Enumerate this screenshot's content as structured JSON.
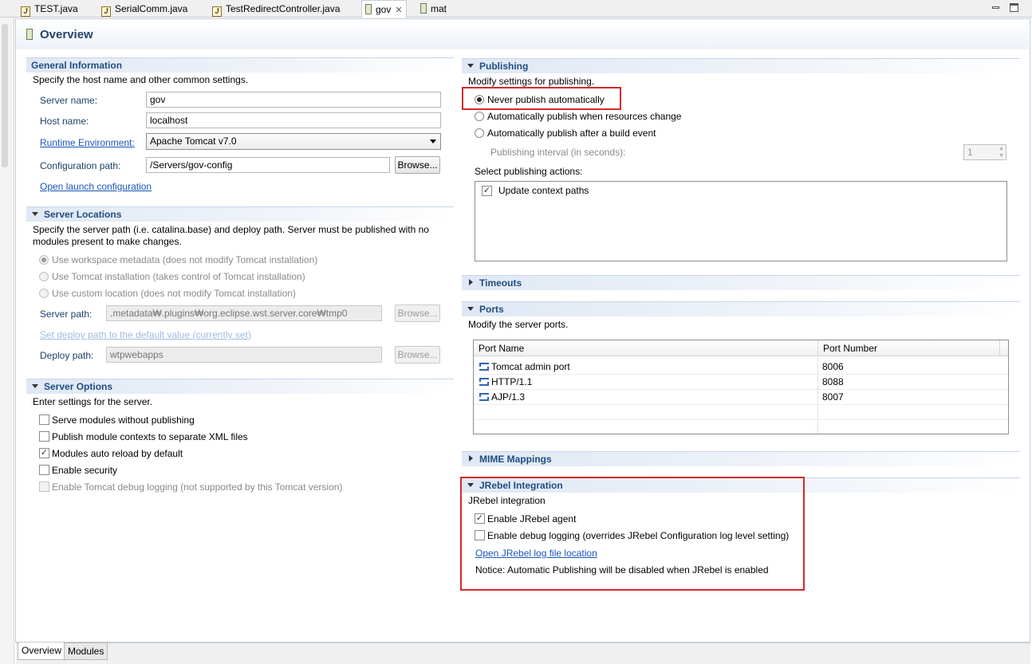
{
  "tabs": [
    {
      "label": "TEST.java",
      "icon": "java-file-icon"
    },
    {
      "label": "SerialComm.java",
      "icon": "java-file-icon"
    },
    {
      "label": "TestRedirectController.java",
      "icon": "java-file-icon"
    },
    {
      "label": "gov",
      "icon": "server-icon",
      "active": true
    },
    {
      "label": "mat",
      "icon": "server-icon"
    }
  ],
  "window_controls": {
    "minimize": "minimize-icon",
    "maximize": "maximize-icon"
  },
  "page_title": "Overview",
  "general": {
    "title": "General Information",
    "desc": "Specify the host name and other common settings.",
    "server_name_label": "Server name:",
    "server_name_value": "gov",
    "host_name_label": "Host name:",
    "host_name_value": "localhost",
    "runtime_label": "Runtime Environment:",
    "runtime_value": "Apache Tomcat v7.0",
    "config_path_label": "Configuration path:",
    "config_path_value": "/Servers/gov-config",
    "browse_label": "Browse...",
    "open_launch_label": "Open launch configuration"
  },
  "locations": {
    "title": "Server Locations",
    "desc1": "Specify the server path (i.e. catalina.base) and deploy path. Server must be published with no",
    "desc2": "modules present to make changes.",
    "opt_workspace": "Use workspace metadata (does not modify Tomcat installation)",
    "opt_tomcat": "Use Tomcat installation (takes control of Tomcat installation)",
    "opt_custom": "Use custom location (does not modify Tomcat installation)",
    "server_path_label": "Server path:",
    "server_path_value": ".metadata₩.plugins₩org.eclipse.wst.server.core₩tmp0",
    "browse_label": "Browse...",
    "set_deploy_label": "Set deploy path to the default value (currently set)",
    "deploy_path_label": "Deploy path:",
    "deploy_path_value": "wtpwebapps"
  },
  "options": {
    "title": "Server Options",
    "desc": "Enter settings for the server.",
    "items": [
      {
        "label": "Serve modules without publishing",
        "checked": false,
        "disabled": false
      },
      {
        "label": "Publish module contexts to separate XML files",
        "checked": false,
        "disabled": false
      },
      {
        "label": "Modules auto reload by default",
        "checked": true,
        "disabled": false
      },
      {
        "label": "Enable security",
        "checked": false,
        "disabled": false
      },
      {
        "label": "Enable Tomcat debug logging (not supported by this Tomcat version)",
        "checked": false,
        "disabled": true
      }
    ]
  },
  "publishing": {
    "title": "Publishing",
    "desc": "Modify settings for publishing.",
    "opt_never": "Never publish automatically",
    "opt_resources": "Automatically publish when resources change",
    "opt_build": "Automatically publish after a build event",
    "interval_label": "Publishing interval (in seconds):",
    "interval_value": "1",
    "actions_label": "Select publishing actions:",
    "action_update": "Update context paths"
  },
  "timeouts": {
    "title": "Timeouts"
  },
  "ports": {
    "title": "Ports",
    "desc": "Modify the server ports.",
    "columns": [
      "Port Name",
      "Port Number"
    ],
    "rows": [
      {
        "name": "Tomcat admin port",
        "number": "8006"
      },
      {
        "name": "HTTP/1.1",
        "number": "8088"
      },
      {
        "name": "AJP/1.3",
        "number": "8007"
      }
    ]
  },
  "mime": {
    "title": "MIME Mappings"
  },
  "jrebel": {
    "title": "JRebel Integration",
    "desc": "JRebel integration",
    "enable_agent": "Enable JRebel agent",
    "enable_debug": "Enable debug logging (overrides JRebel Configuration log level setting)",
    "open_log": "Open JRebel log file location",
    "notice": "Notice: Automatic Publishing will be disabled when JRebel is enabled"
  },
  "bottom_tabs": [
    "Overview",
    "Modules"
  ],
  "colors": {
    "section_title": "#1f4d82",
    "link": "#1a55b8",
    "highlight": "#d42a2a"
  }
}
